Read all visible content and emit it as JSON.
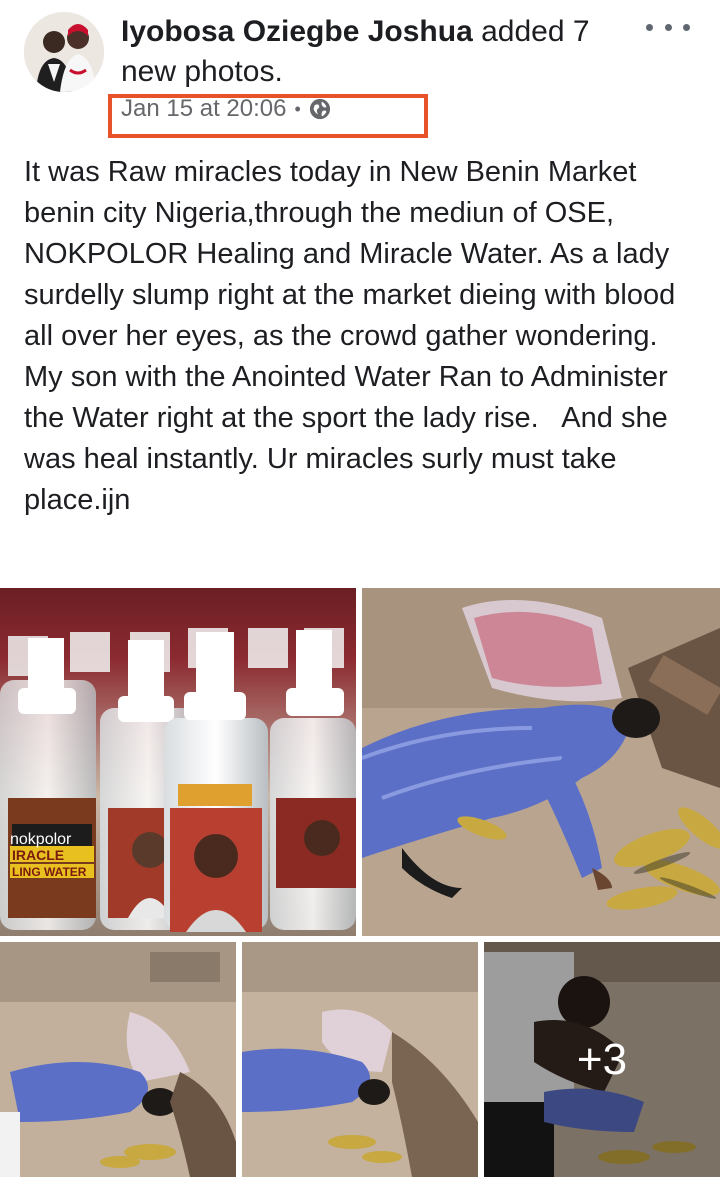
{
  "post": {
    "author_name": "Iyobosa Oziegbe Joshua",
    "action_text": " added 7 new photos.",
    "timestamp": "Jan 15 at 20:06",
    "separator": "•",
    "privacy_icon": "globe-icon",
    "body_text": "It was Raw miracles today in New Benin Market benin city Nigeria,through the mediun of OSE, NOKPOLOR Healing and Miracle Water. As a lady surdelly slump right at the market dieing with blood all over her eyes, as the crowd gather wondering. My son with the Anointed Water Ran to Administer the Water right at the sport the lady rise.   And she was heal instantly. Ur miracles surly must take place.ijn"
  },
  "menu": {
    "icon": "more-horizontal-icon"
  },
  "photos": {
    "bottle_label_brand": "nokpolor",
    "bottle_label_line1": "IRACLE",
    "bottle_label_line2": "LING WATER",
    "more_count": "+3"
  },
  "colors": {
    "highlight": "#e8522b",
    "text": "#1c1e21",
    "secondary": "#65676b"
  }
}
